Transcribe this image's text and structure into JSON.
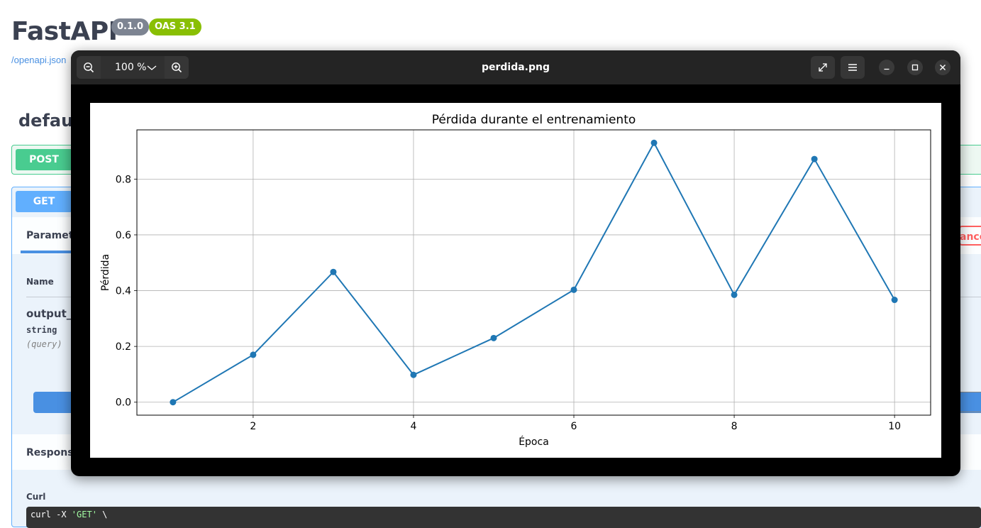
{
  "swagger": {
    "title": "FastAPI",
    "version_badge": "0.1.0",
    "oas_badge": "OAS 3.1",
    "openapi_link": "/openapi.json",
    "tag_title": "defaul",
    "post_method": "POST",
    "get_method": "GET",
    "parameters_tab": "Paramete",
    "cancel_button": "ance",
    "col_name": "Name",
    "param_name": "output_f",
    "param_type": "string",
    "param_in": "(query)",
    "responses_label": "Response",
    "curl_label": "Curl",
    "curl_prefix": "curl -X ",
    "curl_method": "'GET'",
    "curl_suffix": " \\"
  },
  "viewer": {
    "title": "perdida.png",
    "zoom_label": "100 %",
    "icons": {
      "zoom_out": "zoom-out-icon",
      "zoom_in": "zoom-in-icon",
      "fullscreen": "fullscreen-icon",
      "menu": "hamburger-menu-icon",
      "minimize": "minimize-icon",
      "maximize": "maximize-icon",
      "close": "close-icon"
    }
  },
  "chart_data": {
    "type": "line",
    "title": "Pérdida durante el entrenamiento",
    "xlabel": "Época",
    "ylabel": "Pérdida",
    "x": [
      1,
      2,
      3,
      4,
      5,
      6,
      7,
      8,
      9,
      10
    ],
    "series": [
      {
        "values": [
          0.0,
          0.17,
          0.467,
          0.098,
          0.23,
          0.403,
          0.93,
          0.385,
          0.872,
          0.367
        ],
        "color": "#1f77b4"
      }
    ],
    "xticks": [
      2,
      4,
      6,
      8,
      10
    ],
    "yticks": [
      0.0,
      0.2,
      0.4,
      0.6,
      0.8
    ],
    "xtick_labels": [
      "2",
      "4",
      "6",
      "8",
      "10"
    ],
    "ytick_labels": [
      "0.0",
      "0.2",
      "0.4",
      "0.6",
      "0.8"
    ],
    "xlim": [
      0.55,
      10.45
    ],
    "ylim": [
      -0.0465,
      0.9765
    ],
    "grid": true,
    "markers": true
  }
}
